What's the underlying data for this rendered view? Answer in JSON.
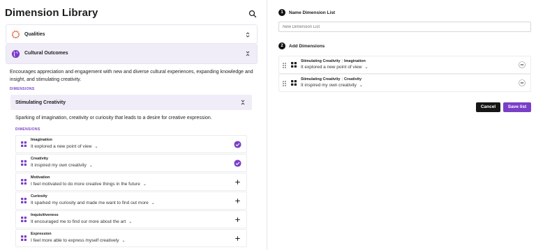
{
  "library": {
    "title": "Dimension Library",
    "qualities_label": "Qualities",
    "cultural_label": "Cultural Outcomes",
    "cultural_description": "Encourages appreciation and engagement with new and diverse cultural experiences, expanding knowledge and insight, and stimulating creativity.",
    "dimensions_heading": "DIMENSIONS",
    "stimulating_label": "Stimulating Creativity",
    "stimulating_description": "Sparking of imagination, creativity or curiosity that leads to a desire for creative expression.",
    "dimensions": [
      {
        "name": "Imagination",
        "question": "It explored a new point of view",
        "state": "added"
      },
      {
        "name": "Creativity",
        "question": "It inspired my own creativity",
        "state": "added"
      },
      {
        "name": "Motivation",
        "question": "I feel motivated to do more creative things in the future",
        "state": "available"
      },
      {
        "name": "Curiosity",
        "question": "It sparked my curiosity and made me want to find out more",
        "state": "available"
      },
      {
        "name": "Inquisitiveness",
        "question": "It encouraged me to find our more about the art",
        "state": "available"
      },
      {
        "name": "Expression",
        "question": "I feel more able to express myself creatively",
        "state": "available"
      }
    ]
  },
  "builder": {
    "step1_number": "1",
    "step1_label": "Name Dimension List",
    "name_placeholder": "New Dimension List",
    "step2_number": "2",
    "step2_label": "Add Dimensions",
    "added": [
      {
        "group": "Stimulating Creativity",
        "name": "Imagination",
        "question": "It explored a new point of view"
      },
      {
        "group": "Stimulating Creativity",
        "name": "Creativity",
        "question": "It inspired my own creativity"
      }
    ],
    "separator": "|",
    "cancel_label": "Cancel",
    "save_label": "Save list"
  },
  "colors": {
    "accent": "#7a3fc8",
    "accent_light": "#f1edf8",
    "qualities_icon": "#e2511f",
    "cancel_bg": "#161616"
  },
  "icons": {
    "search": "search-icon",
    "qualities": "sunburst-icon",
    "cultural": "globe-icon",
    "grid": "grid-icon",
    "added": "check-circle-icon",
    "add": "plus-icon",
    "remove": "minus-circle-icon",
    "drag": "drag-handle-icon"
  }
}
